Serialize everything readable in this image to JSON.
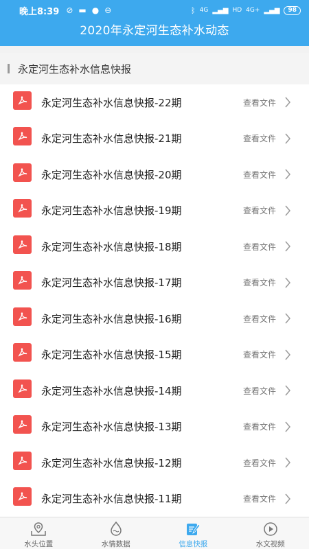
{
  "status_bar": {
    "time": "晚上8:39",
    "battery": "98",
    "net1": "4G",
    "net2": "HD",
    "net3": "4G+"
  },
  "header": {
    "title": "2020年永定河生态补水动态"
  },
  "section": {
    "title": "永定河生态补水信息快报"
  },
  "list": {
    "view_label": "查看文件",
    "items": [
      "永定河生态补水信息快报-22期",
      "永定河生态补水信息快报-21期",
      "永定河生态补水信息快报-20期",
      "永定河生态补水信息快报-19期",
      "永定河生态补水信息快报-18期",
      "永定河生态补水信息快报-17期",
      "永定河生态补水信息快报-16期",
      "永定河生态补水信息快报-15期",
      "永定河生态补水信息快报-14期",
      "永定河生态补水信息快报-13期",
      "永定河生态补水信息快报-12期",
      "永定河生态补水信息快报-11期"
    ]
  },
  "tabs": [
    {
      "label": "水头位置",
      "icon": "map-pin-icon"
    },
    {
      "label": "水情数据",
      "icon": "water-drop-icon"
    },
    {
      "label": "信息快报",
      "icon": "note-edit-icon",
      "active": true
    },
    {
      "label": "水文视频",
      "icon": "play-circle-icon"
    }
  ],
  "colors": {
    "primary": "#3da9ee",
    "pdf": "#f2534f"
  }
}
